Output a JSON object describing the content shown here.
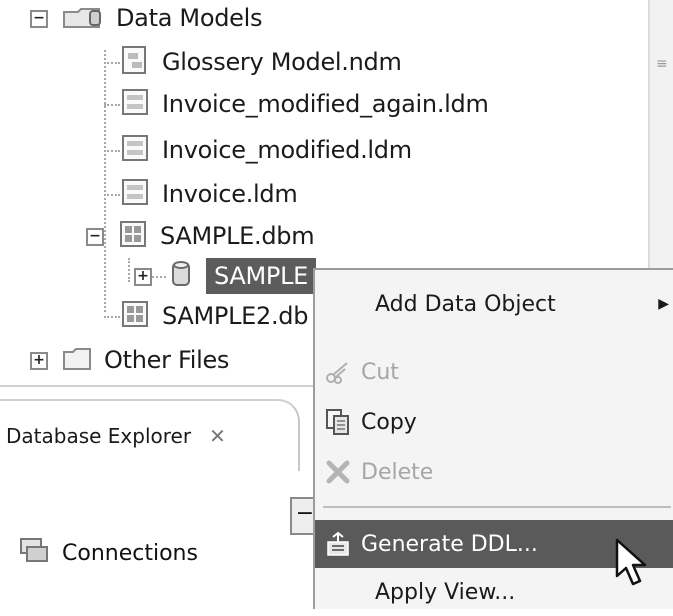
{
  "tree": {
    "data_models": {
      "label": "Data Models",
      "icon": "database-folder-icon",
      "expanded": true
    },
    "items": [
      {
        "label": "Glossery Model.ndm",
        "icon": "glossary-model-icon"
      },
      {
        "label": "Invoice_modified_again.ldm",
        "icon": "logical-model-icon"
      },
      {
        "label": "Invoice_modified.ldm",
        "icon": "logical-model-icon"
      },
      {
        "label": "Invoice.ldm",
        "icon": "logical-model-icon"
      },
      {
        "label": "SAMPLE.dbm",
        "icon": "physical-model-icon",
        "expanded": true
      },
      {
        "label": "SAMPLE",
        "icon": "database-cylinder-icon",
        "selected": true
      },
      {
        "label": "SAMPLE2.db",
        "icon": "physical-model-icon"
      }
    ],
    "other_files": {
      "label": "Other Files",
      "icon": "folder-icon"
    }
  },
  "explorer": {
    "tab_label": "Database Explorer",
    "close_glyph": "✕",
    "connections_label": "Connections",
    "collapse_glyph": "−"
  },
  "context_menu": {
    "items": [
      {
        "label": "Add Data Object",
        "has_submenu": true
      },
      {
        "label": "Cut",
        "disabled": true,
        "icon": "scissors-icon"
      },
      {
        "label": "Copy",
        "icon": "copy-icon"
      },
      {
        "label": "Delete",
        "disabled": true,
        "icon": "delete-icon"
      },
      {
        "label": "Generate DDL...",
        "highlighted": true,
        "icon": "generate-ddl-icon"
      },
      {
        "label": "Apply View...",
        "icon": ""
      }
    ],
    "submenu_arrow": "▶"
  },
  "colors": {
    "selection": "#5c5c5c",
    "menu_bg": "#f4f4f4",
    "disabled_text": "#a6a6a6"
  }
}
